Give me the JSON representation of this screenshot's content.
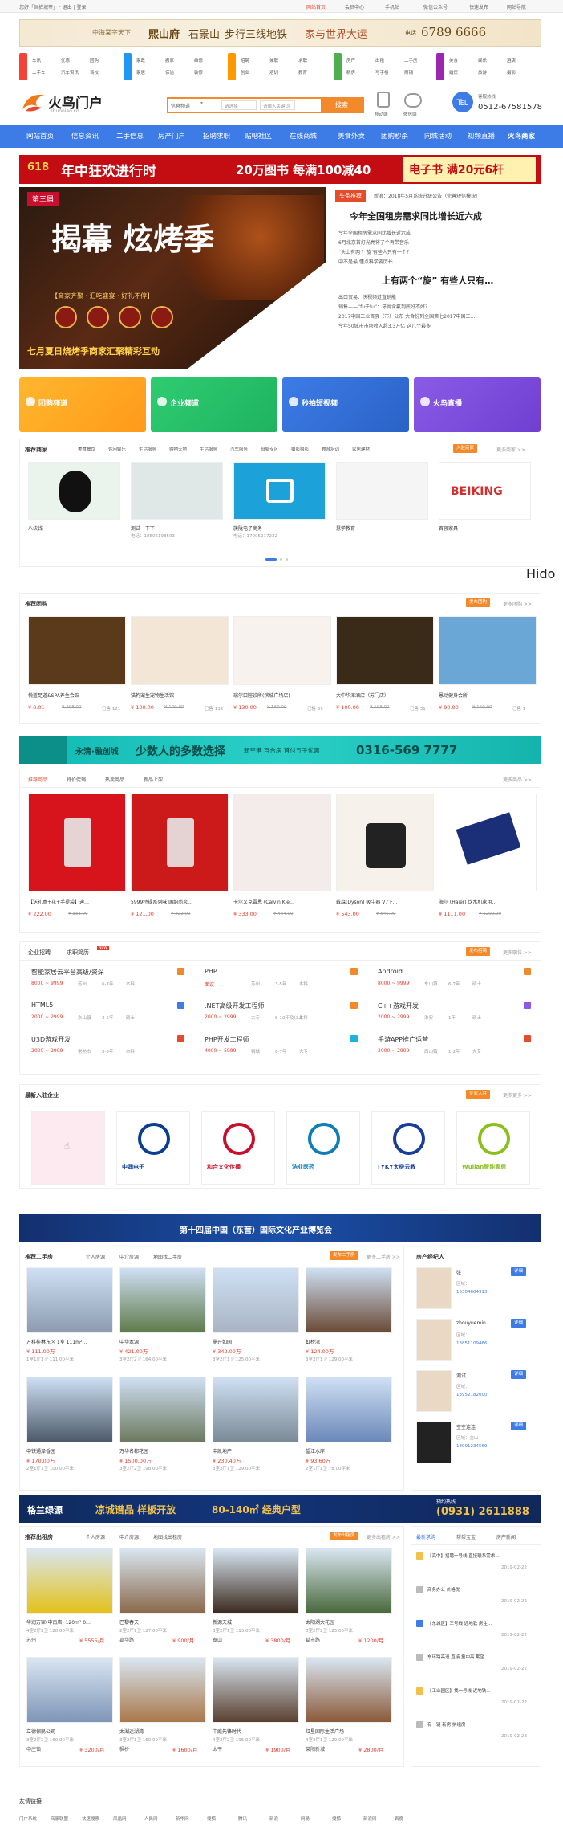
{
  "topbar": {
    "left": "您好「恒拍城市」 · 退出 | 登录",
    "center": "网站首页",
    "links": [
      "会员中心",
      "手机站",
      "微信公众号",
      "快速发布",
      "网站导航"
    ]
  },
  "top_banner": {
    "brand_left": "中海棠字天下",
    "brand_name": "熙山府",
    "slogan_1": "石景山",
    "slogan_2": "步行三线地铁",
    "slogan_3": "家与世界大运",
    "phone_label": "电话",
    "phone": "6789 6666"
  },
  "quick_groups": [
    {
      "color": "#f44336",
      "links": [
        "车讯",
        "优惠",
        "团购",
        "二手车",
        "汽车资讯",
        "驾校"
      ]
    },
    {
      "color": "#2196f3",
      "links": [
        "家政",
        "搬家",
        "维修",
        "家居",
        "保洁",
        "装修"
      ]
    },
    {
      "color": "#ff9800",
      "links": [
        "招聘",
        "兼职",
        "求职",
        "创业",
        "培训",
        "教育"
      ]
    },
    {
      "color": "#4caf50",
      "links": [
        "房产",
        "出租",
        "二手房",
        "新房",
        "写字楼",
        "商铺"
      ]
    },
    {
      "color": "#9c27b0",
      "links": [
        "美食",
        "娱乐",
        "酒店",
        "婚庆",
        "旅游",
        "摄影"
      ]
    }
  ],
  "header": {
    "logo_text": "火鸟门户",
    "logo_sub": "ihuoniao.cn",
    "search_category": "信息频道",
    "search_placeholder_1": "请选择",
    "search_placeholder_2": "请输入关键词",
    "search_button": "搜索",
    "mobile_label": "移动端",
    "wechat_label": "微信端",
    "hotline_label": "客服热线",
    "hotline": "0512-67581578"
  },
  "nav": [
    "网站首页",
    "信息资讯",
    "二手信息",
    "房产门户",
    "招聘求职",
    "贴吧社区",
    "在线商城",
    "美食外卖",
    "团购秒杀",
    "同城活动",
    "视频直播",
    "火鸟商家"
  ],
  "promo": {
    "badge": "618",
    "left_text": "年中狂欢进行时",
    "mid_text": "20万图书 每满100减40",
    "right_text": "电子书 满20元6杆"
  },
  "hero": {
    "label": "第三届",
    "title": "揭幕 炫烤季",
    "subtitle": "七月夏日烧烤季商家汇聚精彩互动",
    "sub_tags": [
      "【商家齐聚 · 汇吃盛宴 · 好礼不停】"
    ]
  },
  "headlines": {
    "badge": "头条推荐",
    "first": "新浪：2018年5月系统升级公告（完善短信模块）",
    "main": "今年全国租房需求同比增长近六成",
    "items": [
      "今年全国租房需求同比增长近六成",
      "6月北京首灯光亮将了个再带音乐",
      "“头上有两个‘旋’有些人只有一个？",
      "中不是最 懂点科学要历长",
      "上有两个“旋” 有些人只有…",
      "出口贸易：沃视频过直销能",
      "销售——“fu于fu”：牙膏含氟到底好不好?",
      "2017中国工业百强（市）公布 大合份列全国第七2017中国工…",
      "今年50城市市场收入超3.3万亿 这几个最多"
    ]
  },
  "channels": [
    "团购频道",
    "企业频道",
    "秒拍短视频",
    "火鸟直播"
  ],
  "recommend": {
    "title": "推荐商家",
    "tabs": [
      "美食餐饮",
      "休闲娱乐",
      "生活服务",
      "购物天地",
      "生活服务",
      "汽车服务",
      "母婴专区",
      "摄影摄影",
      "教育培训",
      "家居建材"
    ],
    "join": "入驻商家",
    "more": "更多商家 >>",
    "items": [
      {
        "name": "八块钱",
        "sub": ""
      },
      {
        "name": "测试一下下",
        "sub": "电话：18506198593"
      },
      {
        "name": "旗陇电子商务",
        "sub": "电话：17005217222"
      },
      {
        "name": "慧学教育",
        "sub": ""
      },
      {
        "name": "百强家具",
        "sub": ""
      }
    ]
  },
  "side_note": "Hido",
  "group": {
    "title": "推荐团购",
    "btn": "发布团购",
    "more": "更多团购 >>",
    "items": [
      {
        "name": "悦蓝足道&SPA养生会馆",
        "price": "¥ 0.01",
        "old": "¥ 298.00",
        "sold": "已售 121"
      },
      {
        "name": "猫狗宠生宠物生活馆",
        "price": "¥ 100.00",
        "old": "¥ 199.00",
        "sold": "已售 132"
      },
      {
        "name": "瑞尔口腔诊所(滨城广场店)",
        "price": "¥ 130.00",
        "old": "¥ 560.00",
        "sold": "已售 39"
      },
      {
        "name": "大中华浑酒店（苏门店）",
        "price": "¥ 100.00",
        "old": "¥ 108.00",
        "sold": "已售 31"
      },
      {
        "name": "恩动健身会所",
        "price": "¥ 90.00",
        "old": "¥ 150.00",
        "sold": "已售 1"
      }
    ]
  },
  "realty_banner": {
    "brand": "永清·融创城",
    "slogan": "少数人的多数选择",
    "area": "新空港 百台房 首付五千优惠",
    "phone": "0316-569 7777"
  },
  "products": {
    "tabs": [
      "推荐商品",
      "特价促销",
      "热卖商品",
      "新品上架"
    ],
    "more": "更多商品 >>",
    "items": [
      {
        "name": "【送礼盒+花+手提袋】迪…",
        "price": "¥ 222.00",
        "old": "¥ 333.00"
      },
      {
        "name": "5999特规系列味 国韵尚炎…",
        "price": "¥ 121.00",
        "old": "¥ 222.00"
      },
      {
        "name": "卡尔文克雷恩 (Calvin Kle…",
        "price": "¥ 333.00",
        "old": "¥ 444.00"
      },
      {
        "name": "戴森(Dyson) 吸尘器 V7 F…",
        "price": "¥ 543.00",
        "old": "¥ 545.00"
      },
      {
        "name": "海尔 (Haier) 饮水机家用…",
        "price": "¥ 1111.00",
        "old": "¥ 1200.00"
      }
    ]
  },
  "jobs": {
    "tabs": [
      "企业招聘",
      "求职简历"
    ],
    "btn": "发布招聘",
    "more": "更多职位 >>",
    "items": [
      {
        "title": "智能家居云平台高级/资深",
        "salary": "8000 ~ 9999",
        "city": "苏州",
        "exp": "6-7年",
        "edu": "本科"
      },
      {
        "title": "PHP",
        "salary": "面议",
        "city": "苏州",
        "exp": "3-5年",
        "edu": "本科"
      },
      {
        "title": "Android",
        "salary": "8000 ~ 9999",
        "city": "东山镇",
        "exp": "6-7年",
        "edu": "硕士"
      },
      {
        "title": "HTML5",
        "salary": "2000 ~ 2999",
        "city": "东山镇",
        "exp": "3-5年",
        "edu": "硕士"
      },
      {
        "title": ".NET高级开发工程师",
        "salary": "2000 ~ 2999",
        "city": "大专",
        "exp": "8-10年及以上",
        "edu": "本科"
      },
      {
        "title": "C++游戏开发",
        "salary": "2000 ~ 2999",
        "city": "淮安",
        "exp": "1年",
        "edu": "硕士"
      },
      {
        "title": "U3D游戏开发",
        "salary": "2000 ~ 2999",
        "city": "常熟市",
        "exp": "3-5年",
        "edu": "本科"
      },
      {
        "title": "PHP开发工程师",
        "salary": "4000 ~ 5999",
        "city": "钢城",
        "exp": "6-7年",
        "edu": "大专"
      },
      {
        "title": "手游APP推广运营",
        "salary": "2000 ~ 2999",
        "city": "西山镇",
        "exp": "1-2年",
        "edu": "大专"
      }
    ]
  },
  "enterprises": {
    "title": "最新入驻企业",
    "btn": "企业入驻",
    "more": "更多更多 >>",
    "items": [
      "",
      "中润电子",
      "和合文化传播",
      "浩业医药",
      "TYKY太极云教",
      "Wulian智能家居"
    ]
  },
  "expo_banner": {
    "text": "第十四届中国（东营）国际文化产业博览会"
  },
  "secondhand": {
    "title": "推荐二手房",
    "tabs": [
      "个人房源",
      "中介房源",
      "地图找二手房"
    ],
    "btn": "发布二手房",
    "more": "更多二手房 >>",
    "items": [
      {
        "name": "万科桂林东区 1室 111m²…",
        "price": "¥ 111.00万",
        "spec": "1室1厅1卫 111.00平米"
      },
      {
        "name": "中华本源",
        "price": "¥ 421.00万",
        "spec": "3室2厅2卫 164.00平米"
      },
      {
        "name": "鼎开如园",
        "price": "¥ 342.00万",
        "spec": "3室2厅1卫 125.00平米"
      },
      {
        "name": "虹桥湾",
        "price": "¥ 124.00万",
        "spec": "3室2厅1卫 129.00平米"
      },
      {
        "name": "中铁通泽香园",
        "price": "¥ 170.00万",
        "spec": "2室1厅1卫 100.00平米"
      },
      {
        "name": "万华名都花园",
        "price": "¥ 1500.00万",
        "spec": "3室2厅2卫 198.00平米"
      },
      {
        "name": "中凯地产",
        "price": "¥ 230.40万",
        "spec": "3室2厅1卫 129.00平米"
      },
      {
        "name": "望江水岸",
        "price": "¥ 93.60万",
        "spec": "2室1厅1卫 78.00平米"
      }
    ]
  },
  "brokers": {
    "title": "房产经纪人",
    "detail": "详细",
    "items": [
      {
        "name": "张",
        "area": "区域：",
        "phone": "15304604913"
      },
      {
        "name": "zhouyuemin",
        "area": "区域：",
        "phone": "13851109466"
      },
      {
        "name": "测试",
        "area": "区域：",
        "phone": "13952182000"
      },
      {
        "name": "空空连连",
        "area": "区域：金山",
        "phone": "18901234569"
      }
    ]
  },
  "ad_banner": {
    "brand": "格兰绿源",
    "title": "凉城谱品 样板开放",
    "offer": "80-140㎡ 经典户型",
    "hotline_label": "预约热线",
    "phone": "(0931) 2611888"
  },
  "rent": {
    "title": "推荐出租房",
    "tabs": [
      "个人房源",
      "中介房源",
      "地图找出租房"
    ],
    "btn": "发布出租房",
    "more": "更多出租房 >>",
    "items": [
      {
        "name": "华润万家(中南店) 120m² 0…",
        "spec": "4室2厅2卫 120.00平米",
        "city": "苏州",
        "price": "¥ 5555/月"
      },
      {
        "name": "巴黎春天",
        "spec": "2室2厅1卫 127.00平米",
        "city": "嘉华路",
        "price": "¥ 900/月"
      },
      {
        "name": "新源天城",
        "spec": "3室2厅1卫 113.00平米",
        "city": "泰山",
        "price": "¥ 3800/月"
      },
      {
        "name": "太阳湖大花园",
        "spec": "3室2厅2卫 125.00平米",
        "city": "葛市路",
        "price": "¥ 1200/月"
      },
      {
        "name": "立德保民公司",
        "spec": "3室2厅2卫 160.00平米",
        "city": "中庄镇",
        "price": "¥ 3200/月"
      },
      {
        "name": "太湖运湖湾",
        "spec": "3室2厅1卫 160.00平米",
        "city": "枫桥",
        "price": "¥ 1600/月"
      },
      {
        "name": "中庭先锋时代",
        "spec": "4室2厅2卫 195.00平米",
        "city": "太平",
        "price": "¥ 1900/月"
      },
      {
        "name": "红星国际生活广场",
        "spec": "4室2厅1卫 129.00平米",
        "city": "莱阳新城",
        "price": "¥ 2800/月"
      }
    ]
  },
  "news": {
    "tabs": [
      "最新求购",
      "帮帮宝宝",
      "房产新闻"
    ],
    "items": [
      {
        "title": "【高中】招聘一号线 直接联系需求…",
        "date": "2019-02-22"
      },
      {
        "title": "商务办公 价格优",
        "date": "2019-02-22"
      },
      {
        "title": "【东城区】三号线 近地铁 房主…",
        "date": "2019-02-22"
      },
      {
        "title": "东环路高速 直接 童中高 期望…",
        "date": "2019-02-22"
      },
      {
        "title": "【工业园区】找一号线 近地铁…",
        "date": "2019-02-22"
      },
      {
        "title": "有一辆 新房 拼组房",
        "date": "2019-02-28"
      }
    ]
  },
  "friend_links": {
    "title": "友情链接",
    "items": [
      "门户系统",
      "商家联盟",
      "快速搜索",
      "凤凰网",
      "人民网",
      "新华网",
      "搜狐",
      "腾讯",
      "新浪",
      "网易",
      "搜狐",
      "新浪网",
      "百度"
    ]
  }
}
